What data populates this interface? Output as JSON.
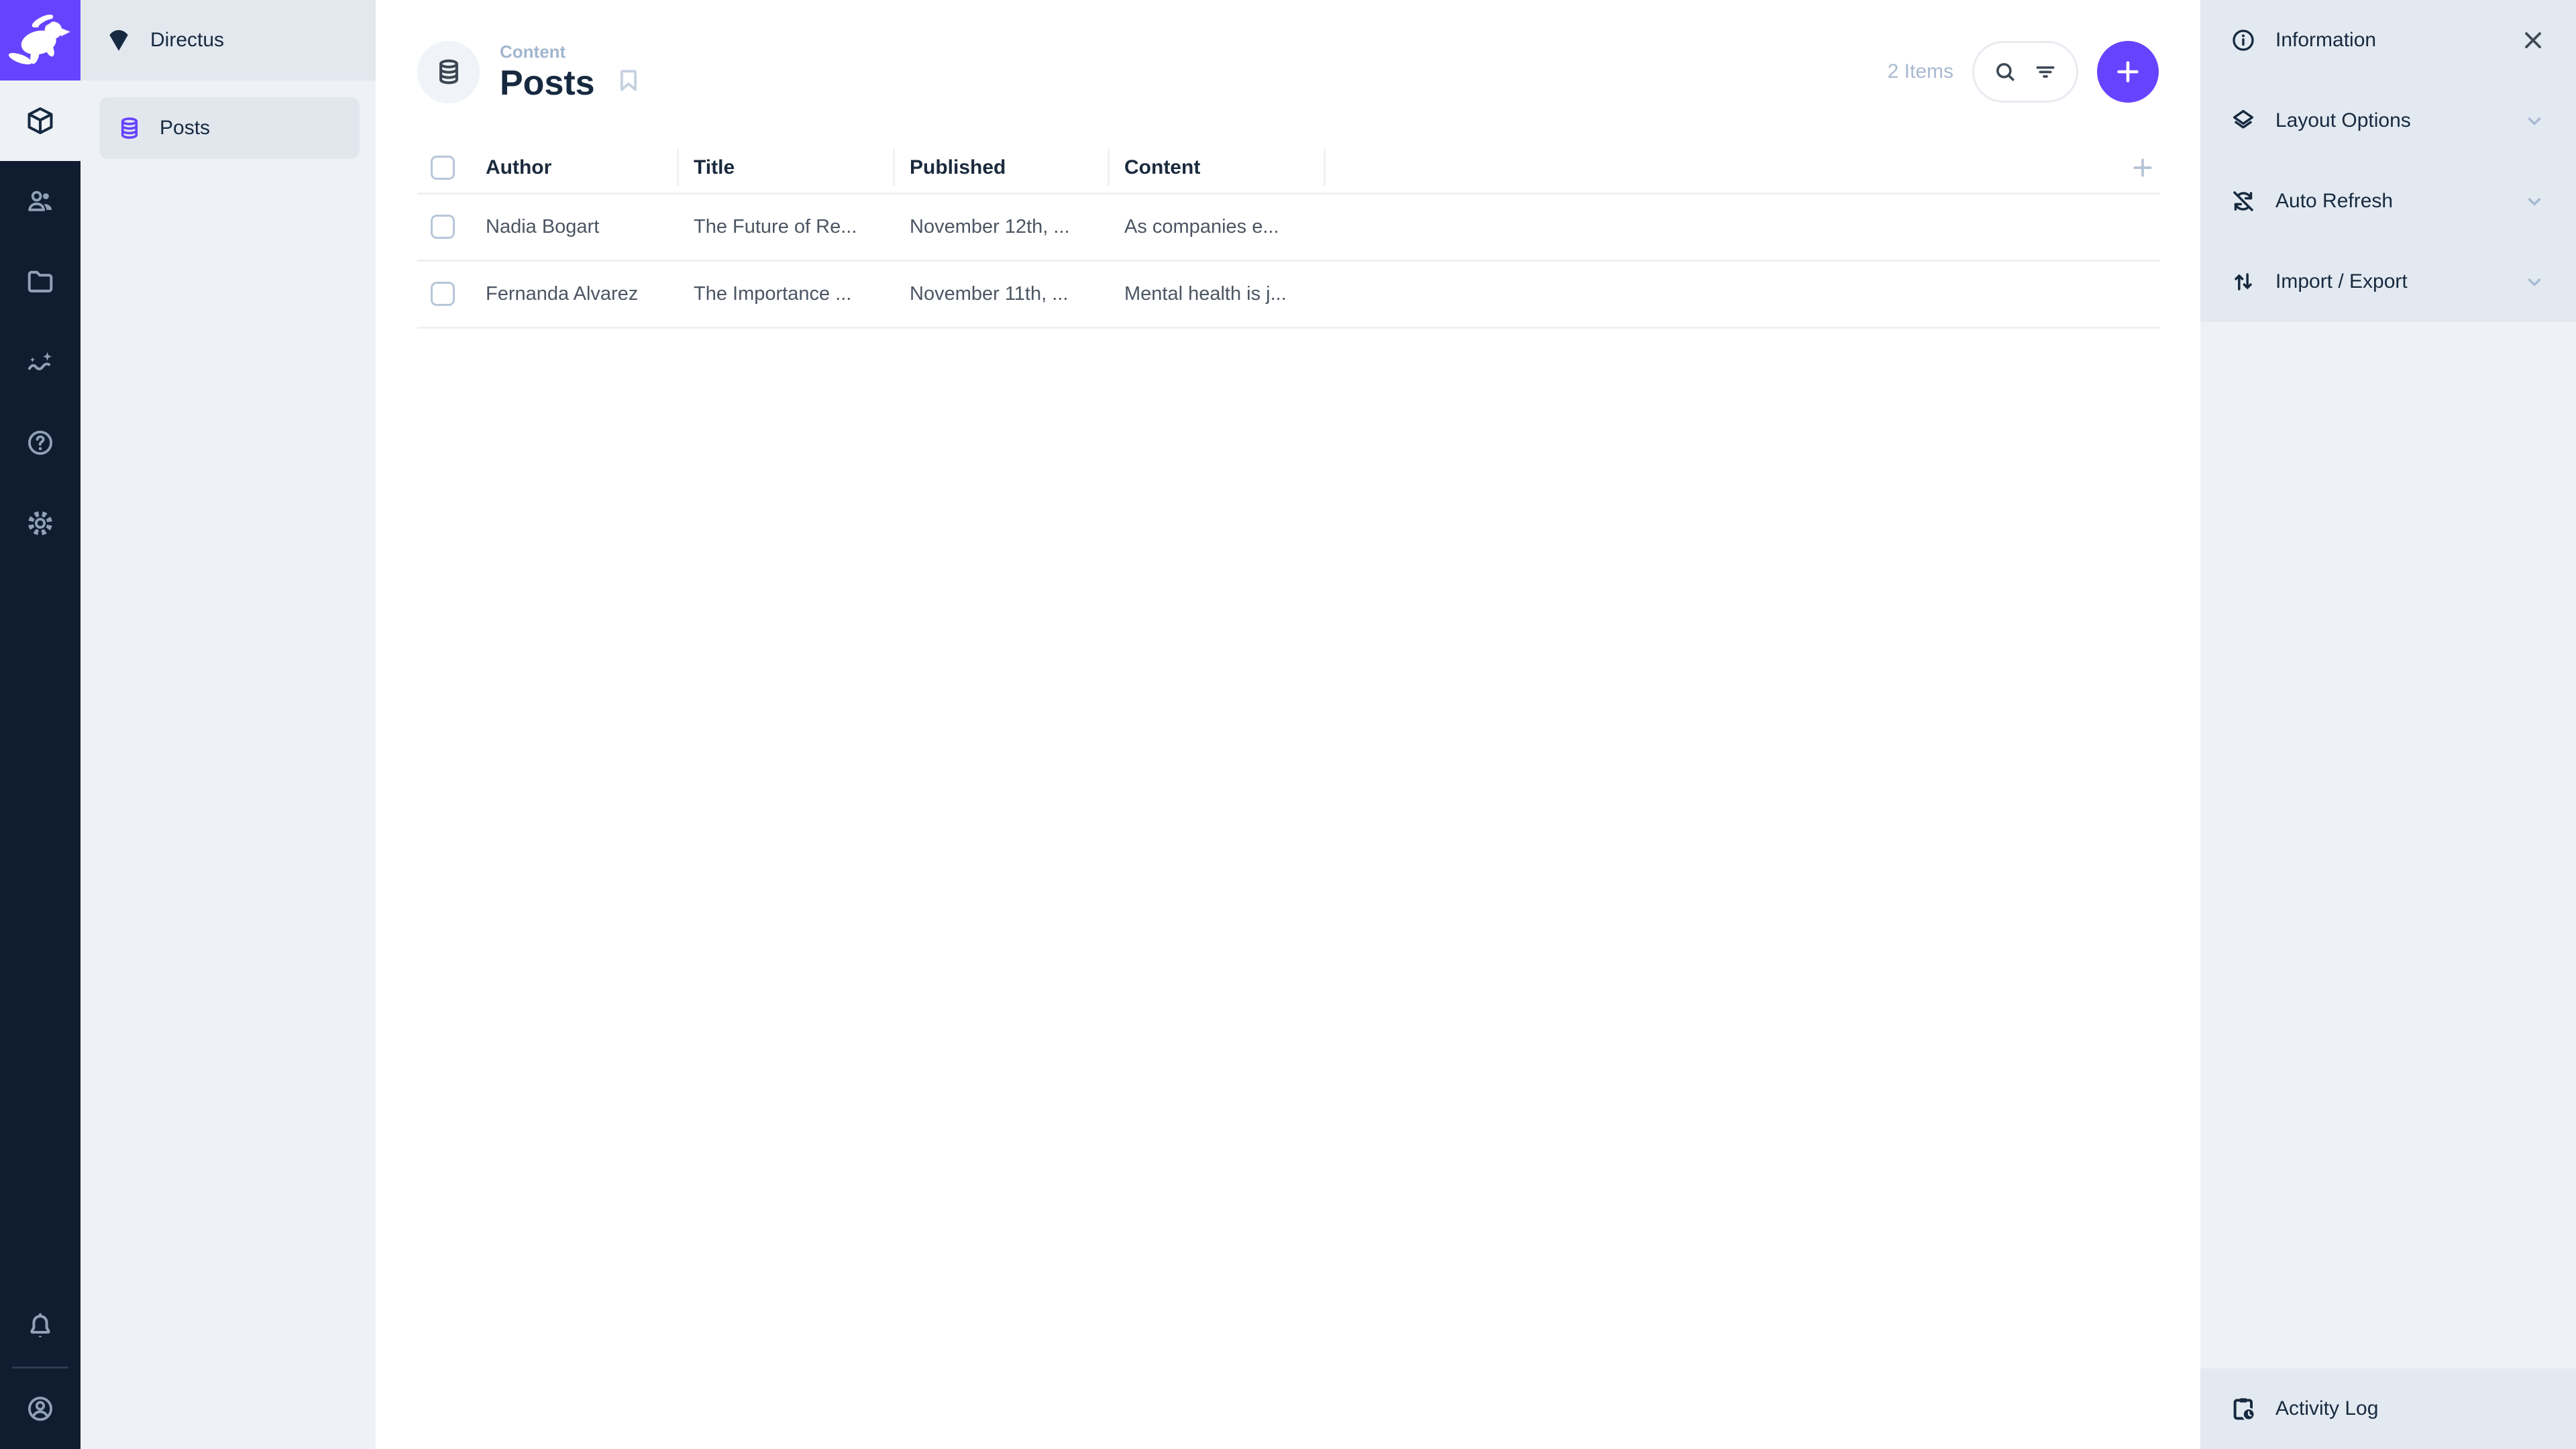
{
  "colors": {
    "accent": "#6644ff",
    "module_bar_bg": "#101c30",
    "module_icon_inactive": "#90a1b5",
    "nav_bg": "#eef1f5",
    "nav_header_bg": "#e3e8ef",
    "sidebar_bg": "#eef2f7",
    "sidebar_section_bg": "#e3e9f0",
    "text_dark": "#16293f",
    "text_cell": "#4c5563",
    "text_muted": "#a9bace",
    "row_border": "#eef1f5"
  },
  "module_bar": {
    "logo_icon": "directus-rabbit-icon",
    "modules": [
      {
        "name": "content",
        "icon": "box-icon",
        "active": true
      },
      {
        "name": "users",
        "icon": "people-icon",
        "active": false
      },
      {
        "name": "files",
        "icon": "folder-icon",
        "active": false
      },
      {
        "name": "insights",
        "icon": "chart-icon",
        "active": false
      },
      {
        "name": "help",
        "icon": "help-icon",
        "active": false
      },
      {
        "name": "settings",
        "icon": "gear-icon",
        "active": false
      }
    ],
    "bottom": [
      {
        "name": "notifications",
        "icon": "bell-icon"
      },
      {
        "name": "account",
        "icon": "account-circle-icon"
      }
    ]
  },
  "nav": {
    "project_name": "Directus",
    "project_icon": "fan-icon",
    "items": [
      {
        "label": "Posts",
        "icon": "database-icon",
        "active": true
      }
    ]
  },
  "header": {
    "breadcrumb": "Content",
    "title": "Posts",
    "title_icon": "database-icon",
    "bookmark_icon": "bookmark-icon",
    "items_count": "2 Items",
    "search_icon": "search-icon",
    "filter_icon": "filter-icon",
    "add_icon": "plus-icon"
  },
  "table": {
    "columns": [
      "Author",
      "Title",
      "Published",
      "Content"
    ],
    "add_column_icon": "plus-icon",
    "rows": [
      {
        "author": "Nadia Bogart",
        "title": "The Future of Re...",
        "published": "November 12th, ...",
        "content": "As companies e..."
      },
      {
        "author": "Fernanda Alvarez",
        "title": "The Importance ...",
        "published": "November 11th, ...",
        "content": "Mental health is j..."
      }
    ]
  },
  "sidebar": {
    "title": "Information",
    "title_icon": "info-icon",
    "close_icon": "close-icon",
    "sections": [
      {
        "label": "Layout Options",
        "icon": "layers-icon"
      },
      {
        "label": "Auto Refresh",
        "icon": "sync-off-icon"
      },
      {
        "label": "Import / Export",
        "icon": "import-export-icon"
      }
    ],
    "footer": {
      "label": "Activity Log",
      "icon": "activity-log-icon"
    }
  }
}
